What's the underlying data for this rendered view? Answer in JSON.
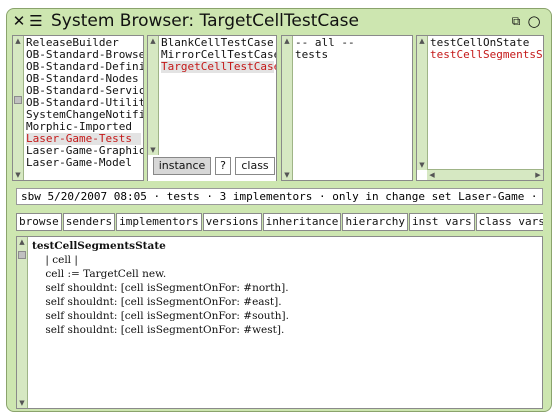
{
  "window": {
    "title": "System Browser: TargetCellTestCase",
    "close_glyph": "✕",
    "menu_glyph": "☰",
    "collapse_glyph": "⧉",
    "expand_glyph": "○"
  },
  "categories": {
    "items": [
      "ReleaseBuilder",
      "OB-Standard-Browsers",
      "OB-Standard-Definitions",
      "OB-Standard-Nodes",
      "OB-Standard-Services",
      "OB-Standard-Utilities",
      "SystemChangeNotification",
      "Morphic-Imported",
      "Laser-Game-Tests",
      "Laser-Game-Graphics",
      "Laser-Game-Model"
    ],
    "selected_index": 8
  },
  "classes": {
    "items": [
      "BlankCellTestCase",
      "MirrorCellTestCase",
      "TargetCellTestCase"
    ],
    "selected_index": 2
  },
  "protocols": {
    "items": [
      "-- all --",
      "tests"
    ]
  },
  "methods": {
    "items": [
      "testCellOnState",
      "testCellSegmentsState"
    ],
    "selected_index": 1
  },
  "toggles": {
    "instance_label": "instance",
    "help_label": "?",
    "class_label": "class"
  },
  "annotation": "sbw 5/20/2007 08:05 · tests · 3 implementors · only in change set Laser-Game ·",
  "nav_buttons": [
    "browse",
    "senders",
    "implementors",
    "versions",
    "inheritance",
    "hierarchy",
    "inst vars",
    "class vars",
    "source"
  ],
  "source": {
    "header": "testCellSegmentsState",
    "lines": [
      "    | cell |",
      "    cell := TargetCell new.",
      "    self shouldnt: [cell isSegmentOnFor: #north].",
      "    self shouldnt: [cell isSegmentOnFor: #east].",
      "    self shouldnt: [cell isSegmentOnFor: #south].",
      "    self shouldnt: [cell isSegmentOnFor: #west]."
    ]
  },
  "colors": {
    "window_bg": "#cde6b0",
    "selection_text": "#c41818",
    "selection_bg": "#e3e3e3"
  }
}
